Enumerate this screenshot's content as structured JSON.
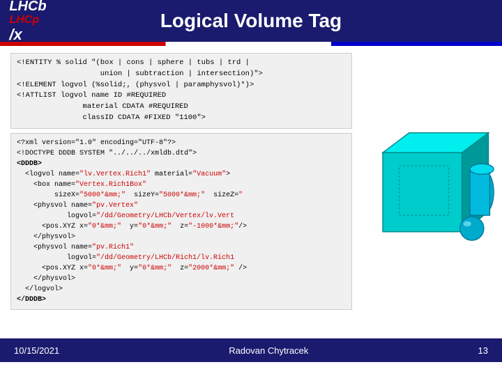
{
  "header": {
    "title": "Logical Volume Tag",
    "logo": {
      "lhcb": "LHCb",
      "lhcp": "LHCp",
      "slash": "/x"
    }
  },
  "xml_block": {
    "line1": "<!ENTITY % solid \"(box | cons | sphere | tubs | trd |",
    "line2": "                    union | subtraction | intersection)\">",
    "line3": "<!ELEMENT logvol (%solid;, (physvol | paramphysvol)*)>",
    "line4": "<!ATTLIST logvol name ID #REQUIRED",
    "line5": "                material CDATA #REQUIRED",
    "line6": "                classID CDATA #FIXED \"1100\">"
  },
  "code_block": {
    "lines": [
      "<?xml version=\"1.0\" encoding=\"UTF-8\"?>",
      "<!DOCTYPE DDDB SYSTEM \"../../xmldb.dtd\">",
      "<DDDB>",
      "  <logvol name=\"lv.Vertex.Rich1\" material=\"Vacuum\">",
      "    <box name=\"Vertex.Rich1Box\"",
      "         sizeX=\"5000*&mm;\"  sizeY=\"5000*&mm;\"  sizeZ=\"",
      "    <physvol name=\"pv.Vertex\"",
      "             logvol=\"/dd/Geometry/LHCb/Vertex/lv.Vert",
      "      <pos.XYZ x=\"0*&mm;\"  y=\"0*&mm;\"  z=\"-1000*&mm;\"/>",
      "    </physvol>",
      "    <physvol name=\"pv.Rich1\"",
      "             logvol=\"/dd/Geometry/LHCb/Rich1/lv.Rich1",
      "      <pos.XYZ x=\"0*&mm;\"  y=\"0*&mm;\"  z=\"2000*&mm;\" />",
      "    </physvol>",
      "  </logvol>",
      "</DDDB>"
    ]
  },
  "footer": {
    "left": "10/15/2021",
    "center": "Radovan Chytracek",
    "right": "13"
  }
}
